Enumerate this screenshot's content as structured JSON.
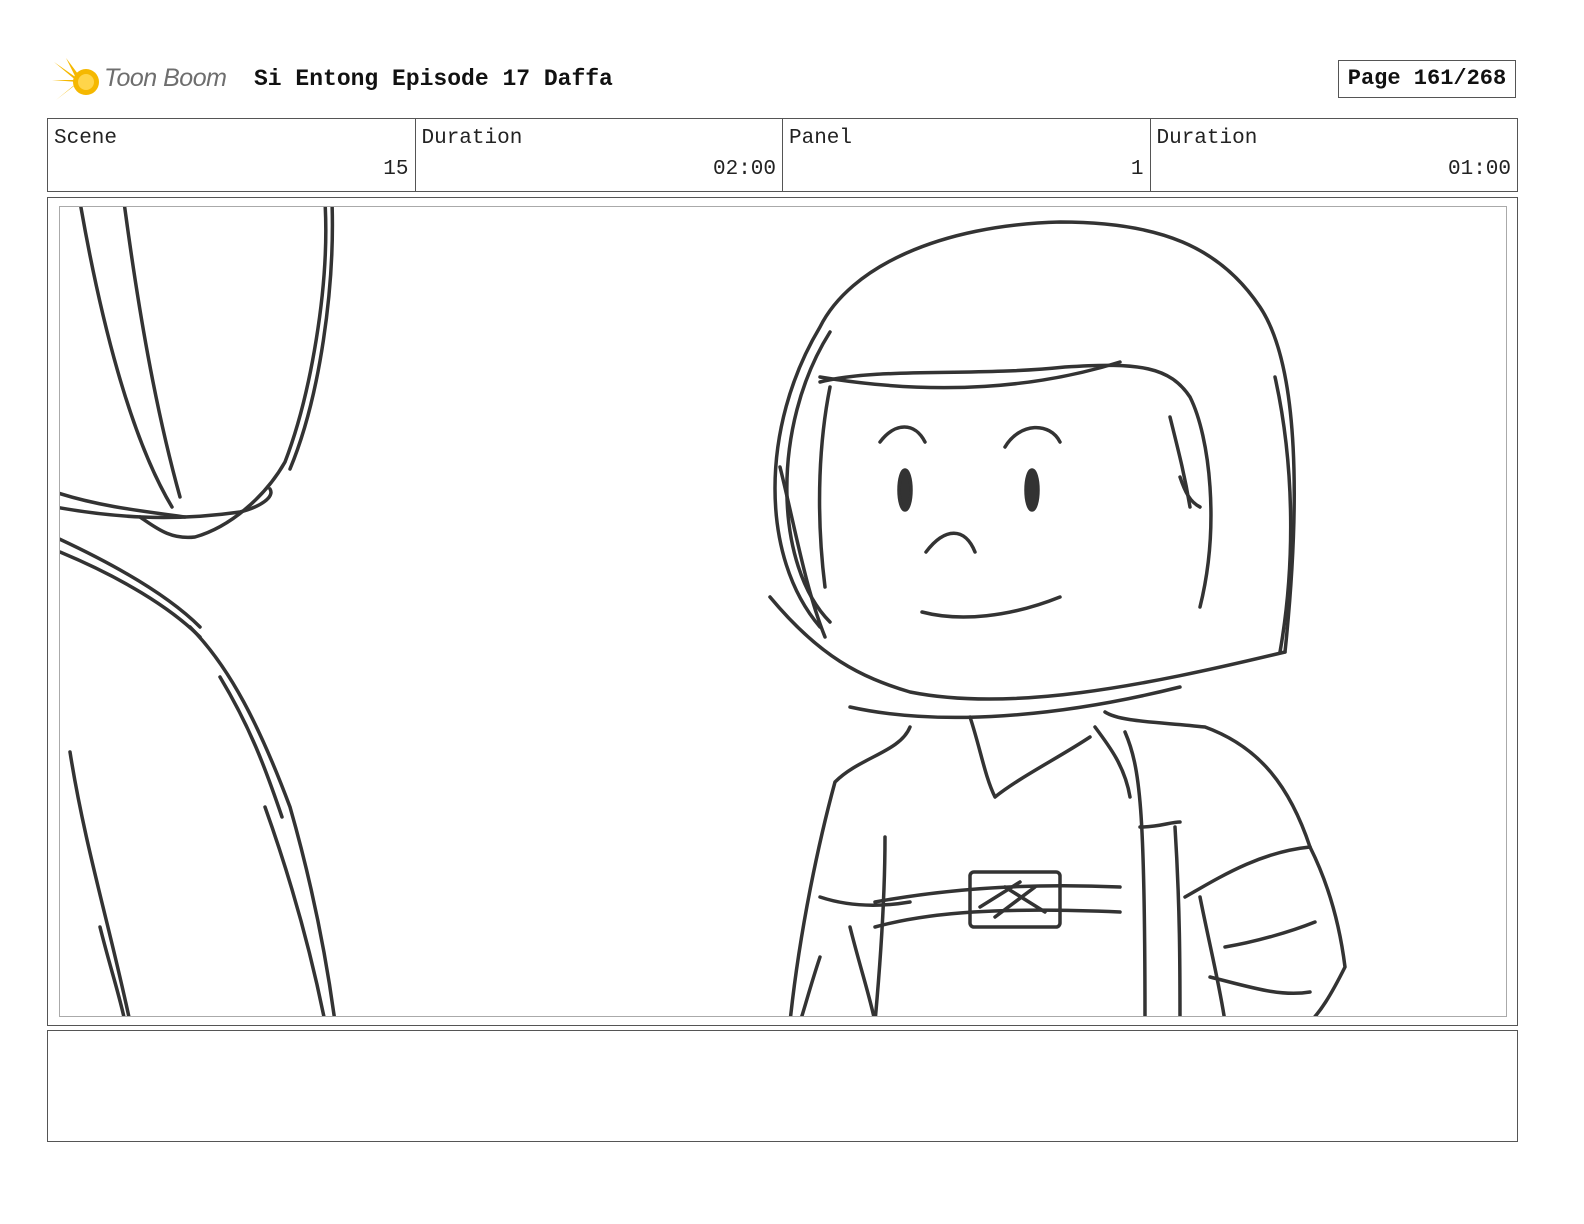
{
  "header": {
    "logo_text": "Toon Boom",
    "title": "Si Entong Episode 17 Daffa",
    "page": "Page 161/268"
  },
  "info": [
    {
      "label": "Scene",
      "value": "15"
    },
    {
      "label": "Duration",
      "value": "02:00"
    },
    {
      "label": "Panel",
      "value": "1"
    },
    {
      "label": "Duration",
      "value": "01:00"
    }
  ],
  "colors": {
    "logo_star": "#f5b800",
    "line": "#333333",
    "border": "#555555"
  },
  "panel": {
    "drawing_icon": "storyboard-sketch"
  },
  "notes": ""
}
